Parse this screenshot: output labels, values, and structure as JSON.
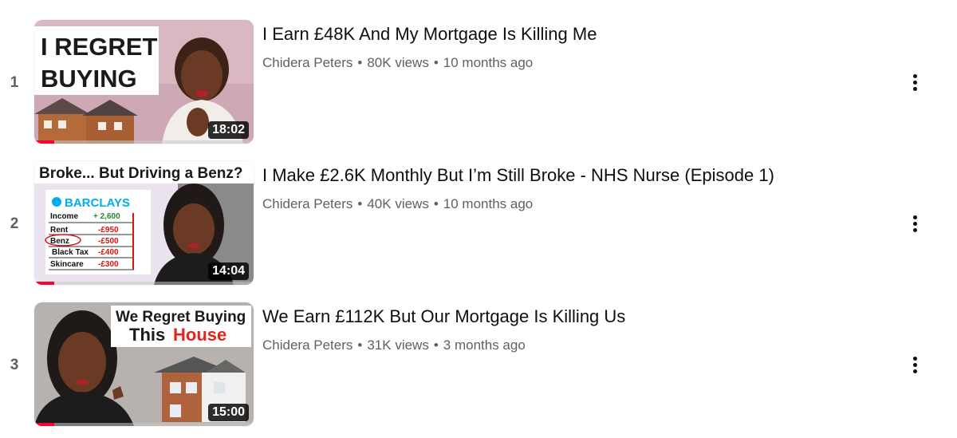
{
  "videos": [
    {
      "index": "1",
      "title": "I Earn £48K And My Mortgage Is Killing Me",
      "channel": "Chidera Peters",
      "views": "80K views",
      "age": "10 months ago",
      "duration": "18:02",
      "watched_fraction": 0.09,
      "thumbnail_text": [
        "I REGRET",
        "BUYING"
      ]
    },
    {
      "index": "2",
      "title": "I Make £2.6K Monthly But I’m Still Broke - NHS Nurse (Episode 1)",
      "channel": "Chidera Peters",
      "views": "40K views",
      "age": "10 months ago",
      "duration": "14:04",
      "watched_fraction": 0.09,
      "thumbnail_text": {
        "banner": "Broke... But Driving a Benz?",
        "bank": "BARCLAYS",
        "rows": [
          {
            "label": "Income",
            "amount": "+ 2,600"
          },
          {
            "label": "Rent",
            "amount": "-£950"
          },
          {
            "label": "Benz",
            "amount": "-£500"
          },
          {
            "label": "Black Tax",
            "amount": "-£400"
          },
          {
            "label": "Skincare",
            "amount": "-£300"
          }
        ]
      }
    },
    {
      "index": "3",
      "title": "We Earn £112K But Our Mortgage Is Killing Us",
      "channel": "Chidera Peters",
      "views": "31K views",
      "age": "3 months ago",
      "duration": "15:00",
      "watched_fraction": 0.09,
      "thumbnail_text": [
        "We Regret Buying",
        "This",
        "House"
      ]
    }
  ],
  "colors": {
    "progress": "#ff0033",
    "accent_red": "#e0261b",
    "text_secondary": "#606060"
  },
  "icons": {
    "menu": "more-vertical-icon"
  }
}
